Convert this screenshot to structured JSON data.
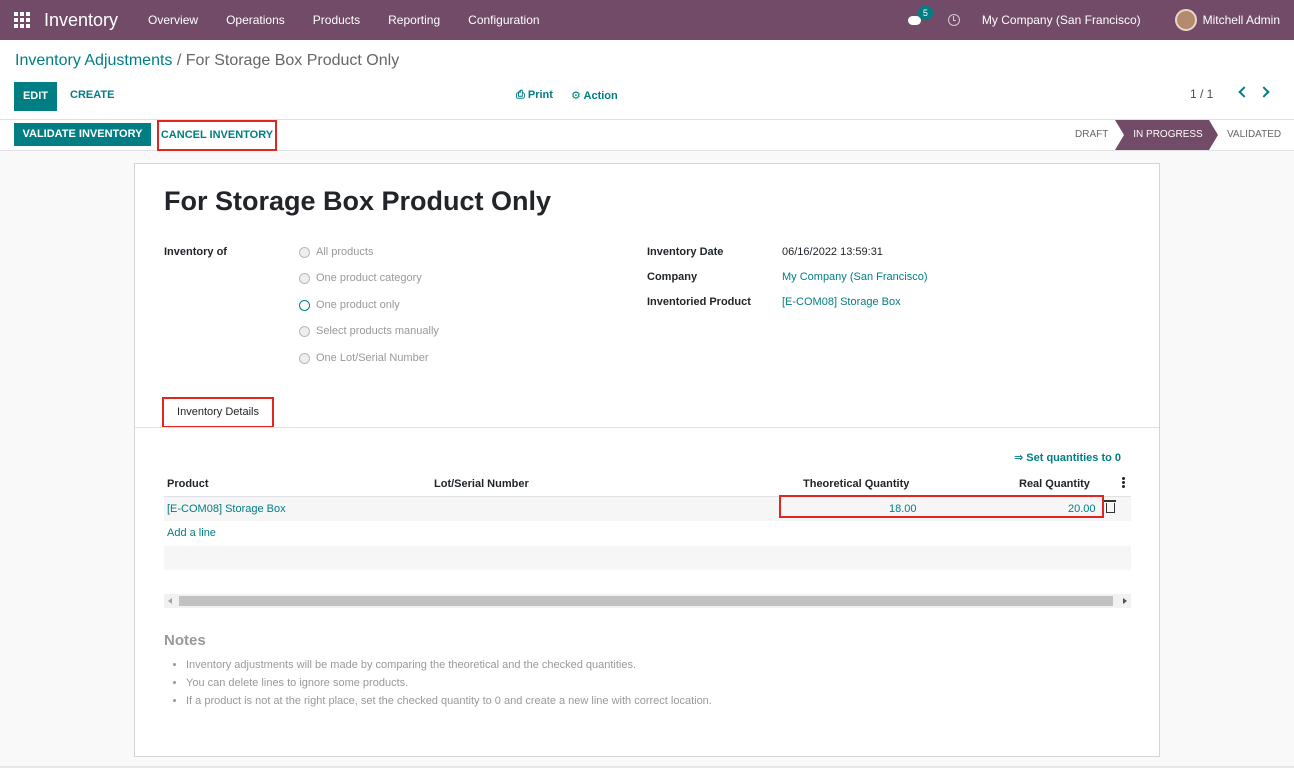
{
  "navbar": {
    "app_name": "Inventory",
    "menu": [
      "Overview",
      "Operations",
      "Products",
      "Reporting",
      "Configuration"
    ],
    "messages_count": "5",
    "company": "My Company (San Francisco)",
    "user": "Mitchell Admin"
  },
  "breadcrumb": {
    "parent": "Inventory Adjustments",
    "separator": " / ",
    "current": "For Storage Box Product Only"
  },
  "control": {
    "edit_label": "EDIT",
    "create_label": "CREATE",
    "print_label": "Print",
    "action_label": "Action",
    "pager": "1 / 1"
  },
  "statusbar": {
    "validate_label": "VALIDATE INVENTORY",
    "cancel_label": "CANCEL INVENTORY",
    "stages": [
      "DRAFT",
      "IN PROGRESS",
      "VALIDATED"
    ],
    "active_stage": "IN PROGRESS"
  },
  "form": {
    "title": "For Storage Box Product Only",
    "inventory_of_label": "Inventory of",
    "inventory_of_options": [
      "All products",
      "One product category",
      "One product only",
      "Select products manually",
      "One Lot/Serial Number"
    ],
    "inventory_of_selected": "One product only",
    "date_label": "Inventory Date",
    "date_value": "06/16/2022 13:59:31",
    "company_label": "Company",
    "company_value": "My Company (San Francisco)",
    "product_label": "Inventoried Product",
    "product_value": "[E-COM08] Storage Box"
  },
  "details": {
    "tab_label": "Inventory Details",
    "set_qty_label": "⇒ Set quantities to 0",
    "columns": [
      "Product",
      "Lot/Serial Number",
      "Theoretical Quantity",
      "Real Quantity"
    ],
    "rows": [
      {
        "product": "[E-COM08] Storage Box",
        "lot": "",
        "theoretical": "18.00",
        "real": "20.00"
      }
    ],
    "add_line": "Add a line"
  },
  "notes": {
    "title": "Notes",
    "items": [
      "Inventory adjustments will be made by comparing the theoretical and the checked quantities.",
      "You can delete lines to ignore some products.",
      "If a product is not at the right place, set the checked quantity to 0 and create a new line with correct location."
    ]
  },
  "colors": {
    "brand": "#714b67",
    "accent": "#017e84",
    "highlight": "#e0261f"
  }
}
